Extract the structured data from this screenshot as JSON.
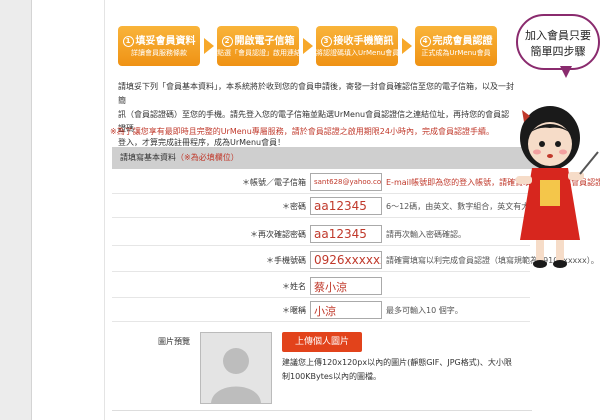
{
  "steps": [
    {
      "num": "1",
      "title": "填妥會員資料",
      "sub": "詳讀會員服務條款"
    },
    {
      "num": "2",
      "title": "開啟電子信箱",
      "sub": "點選「會員認證」啟用連結"
    },
    {
      "num": "3",
      "title": "接收手機簡訊",
      "sub": "將認證碼填入UrMenu會員認證"
    },
    {
      "num": "4",
      "title": "完成會員認證",
      "sub": "正式成為UrMenu會員"
    }
  ],
  "bubble": {
    "line1": "加入會員只要",
    "line2": "簡單四步驟"
  },
  "intro": {
    "line1": "請填妥下列「會員基本資料」，本系統將於收到您的會員申請後，寄發一封會員確認信至您的電子信箱，以及一封簡",
    "line2": "訊（會員認證碼）至您的手機。請先登入您的電子信箱並點選UrMenu會員認證信之連結位址，再持您的會員認證碼",
    "line3": "登入，才算完成註冊程序，成為UrMenu會員！"
  },
  "note": "※為了讓您享有最即時且完整的UrMenu專屬服務，請於會員認證之啟用期限24小時內，完成會員認證手續。",
  "form": {
    "header": "請填寫基本資料",
    "required": "（※為必填欄位）",
    "rows": [
      {
        "label": "＊帳號／電子信箱",
        "value": "sant628@yahoo.com.tw",
        "hint": "E-mail帳號即為您的登入帳號，請確實填寫以利完成會員認證。"
      },
      {
        "label": "＊密碼",
        "value": "aa12345",
        "hint": "6～12碼，由英文、數字組合，英文有大小寫之分。"
      },
      {
        "label": "＊再次確認密碼",
        "value": "aa12345",
        "hint": "請再次輸入密碼確認。"
      },
      {
        "label": "＊手機號碼",
        "value": "0926xxxxxx",
        "hint": "請確實填寫以利完成會員認證（填寫規範為0910xxxxxx）。"
      },
      {
        "label": "＊姓名",
        "value": "蔡小涼",
        "hint": ""
      },
      {
        "label": "＊暱稱",
        "value": "小涼",
        "hint": "最多可輸入10 個字。"
      }
    ],
    "photo_label": "圖片預覽",
    "upload_button": "上傳個人圖片",
    "photo_hint": "建議您上傳120x120px以內的圖片(靜態GIF、JPG格式)、大小限制100KBytes以內的圖檔。"
  }
}
